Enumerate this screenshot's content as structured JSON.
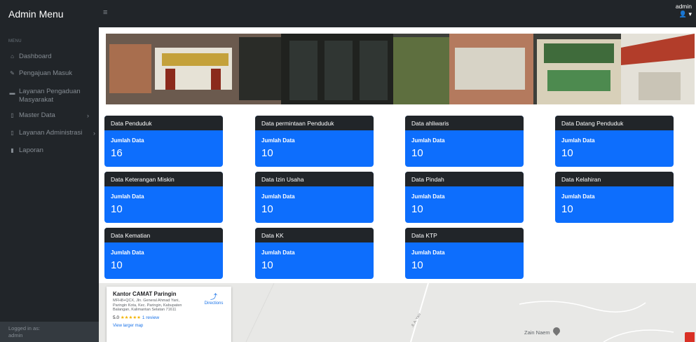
{
  "brand": "Admin Menu",
  "sidebar": {
    "heading": "MENU",
    "items": [
      {
        "icon": "home-icon",
        "glyph": "⌂",
        "label": "Dashboard"
      },
      {
        "icon": "edit-icon",
        "glyph": "✎",
        "label": "Pengajuan Masuk"
      },
      {
        "icon": "inbox-icon",
        "glyph": "▬",
        "label": "Layanan Pengaduan Masyarakat"
      },
      {
        "icon": "file-icon",
        "glyph": "▯",
        "label": "Master Data",
        "chevron": "›"
      },
      {
        "icon": "file-icon",
        "glyph": "▯",
        "label": "Layanan Administrasi",
        "chevron": "›"
      },
      {
        "icon": "chart-icon",
        "glyph": "▮",
        "label": "Laporan"
      }
    ],
    "footer_label": "Logged in as:",
    "footer_user": "admin"
  },
  "topbar": {
    "toggle_glyph": "≡",
    "user_name": "admin",
    "user_glyph": "👤 ▾"
  },
  "cards": [
    {
      "title": "Data Penduduk",
      "label": "Jumlah Data",
      "value": "16"
    },
    {
      "title": "Data permintaan Penduduk",
      "label": "Jumlah Data",
      "value": "10"
    },
    {
      "title": "Data ahliwaris",
      "label": "Jumlah Data",
      "value": "10"
    },
    {
      "title": "Data Datang Penduduk",
      "label": "Jumlah Data",
      "value": "10"
    },
    {
      "title": "Data Keterangan Miskin",
      "label": "Jumlah Data",
      "value": "10"
    },
    {
      "title": "Data Izin Usaha",
      "label": "Jumlah Data",
      "value": "10"
    },
    {
      "title": "Data Pindah",
      "label": "Jumlah Data",
      "value": "10"
    },
    {
      "title": "Data Kelahiran",
      "label": "Jumlah Data",
      "value": "10"
    },
    {
      "title": "Data Kematian",
      "label": "Jumlah Data",
      "value": "10"
    },
    {
      "title": "Data KK",
      "label": "Jumlah Data",
      "value": "10"
    },
    {
      "title": "Data KTP",
      "label": "Jumlah Data",
      "value": "10"
    }
  ],
  "map": {
    "place_title": "Kantor CAMAT Paringin",
    "address": "MFH8+QCX, Jln. General Ahmad Yani, Paringin Kota, Kec. Paringin, Kabupaten Balangan, Kalimantan Selatan 71611",
    "rating": "5.0",
    "stars": "★★★★★",
    "reviews": "1 review",
    "directions": "Directions",
    "larger_map": "View larger map",
    "nearby_place": "Zain Naem",
    "road": "Jl. A. Yani"
  },
  "colors": {
    "sidebar_bg": "#212529",
    "card_body": "#0d6efd",
    "card_head": "#212529"
  }
}
